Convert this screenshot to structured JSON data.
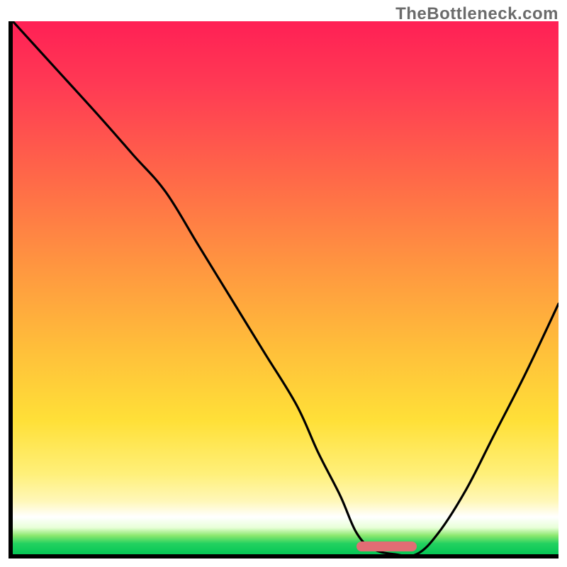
{
  "watermark": "TheBottleneck.com",
  "colors": {
    "axis": "#000000",
    "curve": "#000000",
    "marker": "#e26d74",
    "gradient_top": "#ff2055",
    "gradient_bottom": "#05c755"
  },
  "chart_data": {
    "type": "line",
    "title": "",
    "xlabel": "",
    "ylabel": "",
    "xlim": [
      0,
      100
    ],
    "ylim": [
      0,
      100
    ],
    "grid": false,
    "legend": false,
    "series": [
      {
        "name": "bottleneck-curve",
        "x": [
          0,
          8,
          16,
          22,
          28,
          34,
          40,
          46,
          52,
          56,
          60,
          63,
          66,
          70,
          74,
          78,
          83,
          88,
          94,
          100
        ],
        "y": [
          100,
          91,
          82,
          75,
          68,
          58,
          48,
          38,
          28,
          19,
          11,
          4,
          1,
          0,
          0,
          4,
          12,
          22,
          34,
          47
        ]
      }
    ],
    "annotations": [
      {
        "name": "optimal-range-marker",
        "x_start": 63,
        "x_end": 74,
        "y": 0
      }
    ]
  }
}
